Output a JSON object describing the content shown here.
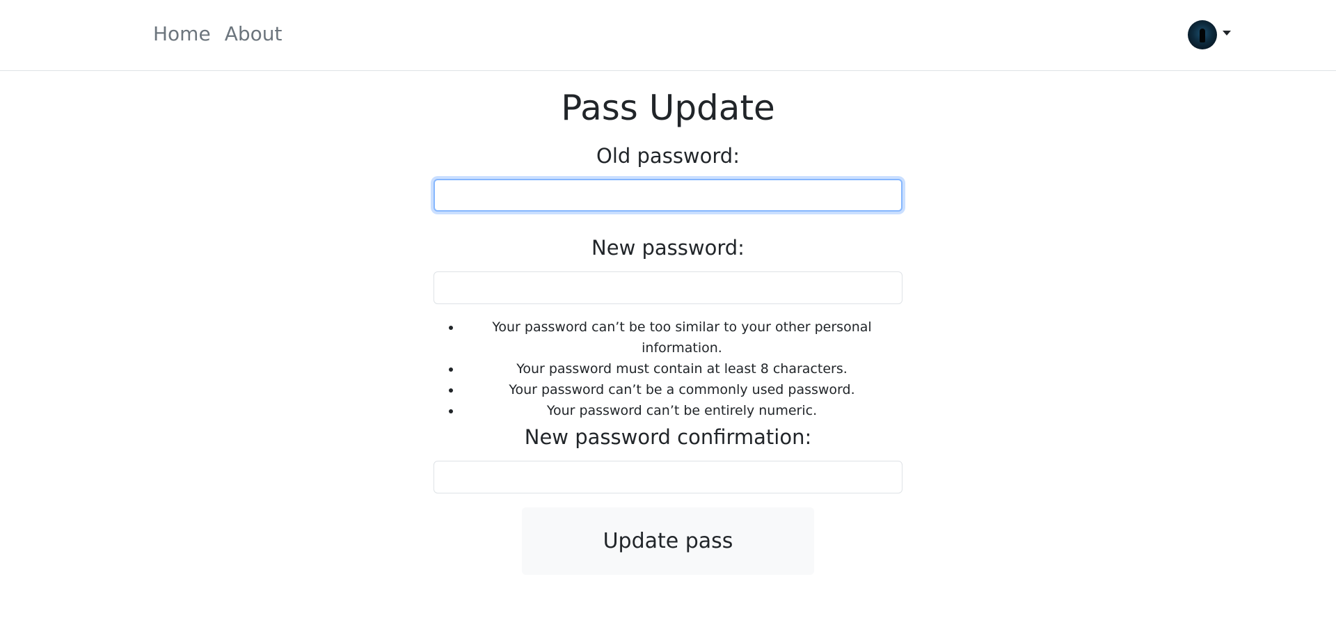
{
  "nav": {
    "links": [
      {
        "label": "Home"
      },
      {
        "label": "About"
      }
    ]
  },
  "user_menu": {
    "avatar_icon": "user-avatar-icon",
    "dropdown_icon": "caret-down-icon"
  },
  "page": {
    "title": "Pass Update"
  },
  "form": {
    "old_password": {
      "label": "Old password:",
      "value": "",
      "placeholder": ""
    },
    "new_password": {
      "label": "New password:",
      "value": "",
      "placeholder": ""
    },
    "help_text": [
      "Your password can’t be too similar to your other personal information.",
      "Your password must contain at least 8 characters.",
      "Your password can’t be a commonly used password.",
      "Your password can’t be entirely numeric."
    ],
    "confirm_password": {
      "label": "New password confirmation:",
      "value": "",
      "placeholder": ""
    },
    "submit_label": "Update pass"
  },
  "colors": {
    "nav_link": "#6c757d",
    "focus_ring": "#86b7fe",
    "button_bg": "#f8f9fa"
  }
}
